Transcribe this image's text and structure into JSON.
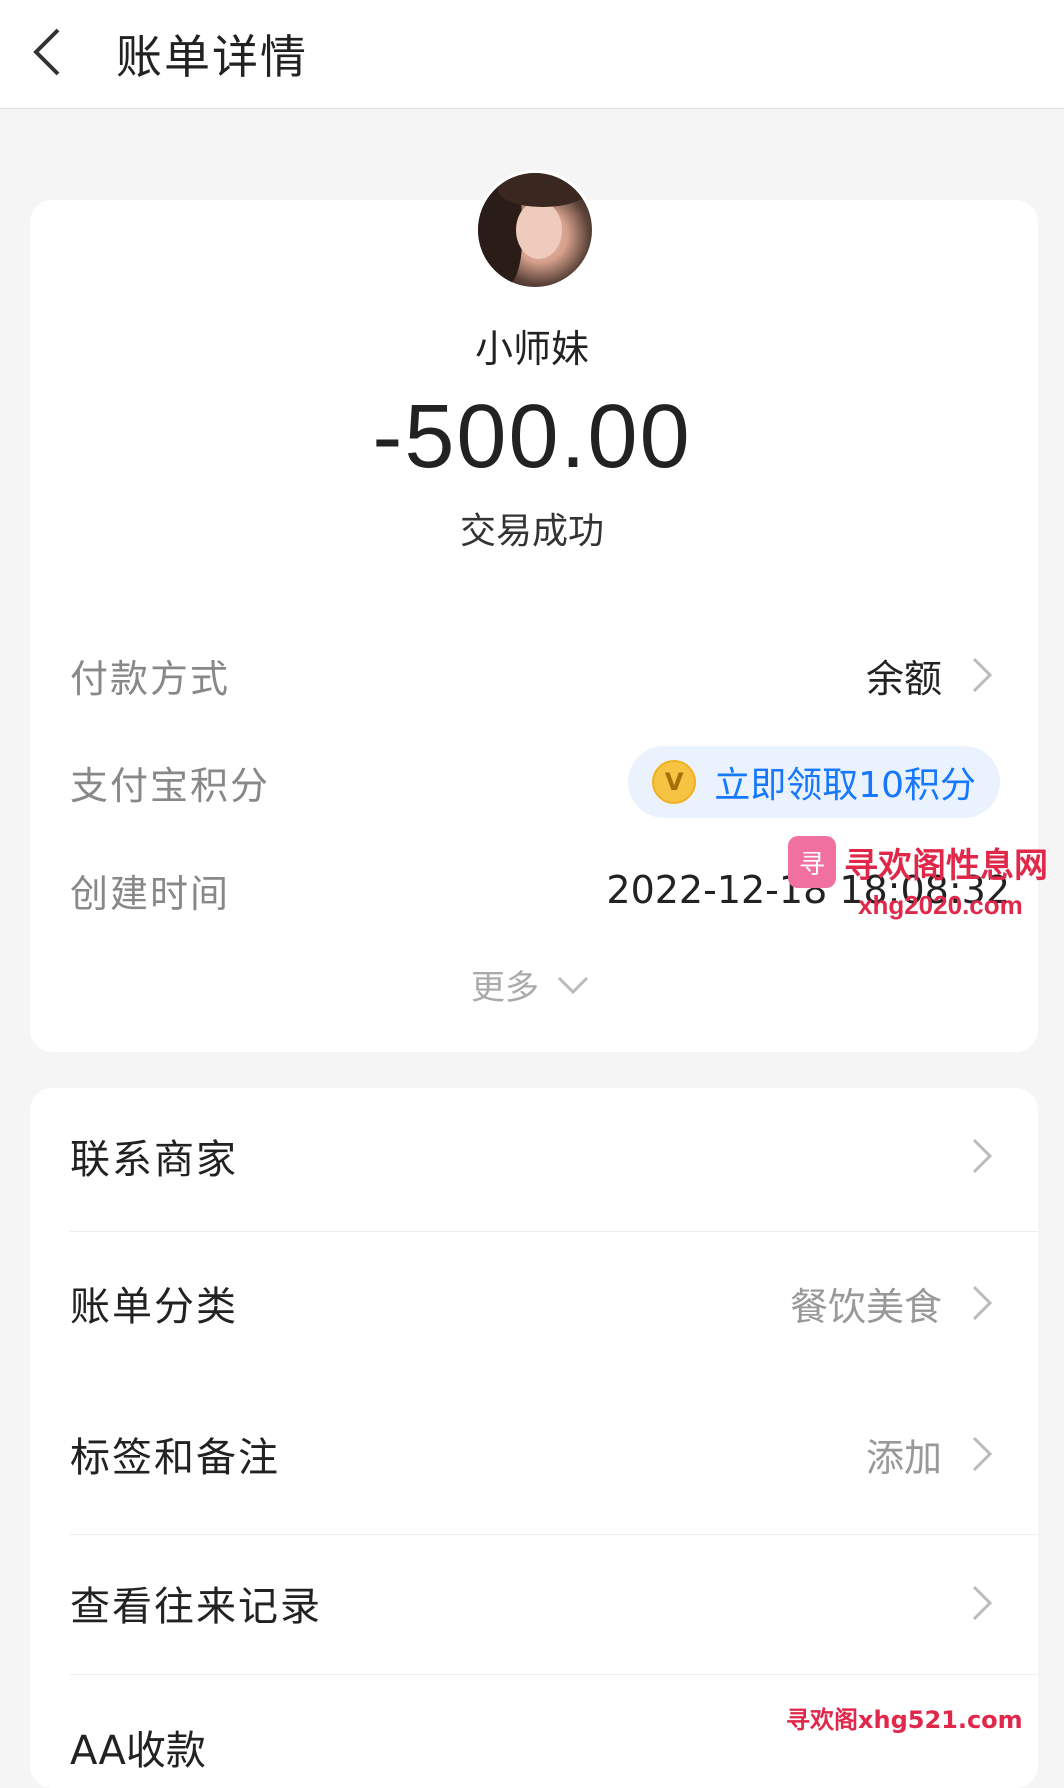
{
  "header": {
    "title": "账单详情",
    "back_icon": "back-arrow-icon"
  },
  "transaction": {
    "payee": "小师妹",
    "amount": "-500.00",
    "status": "交易成功"
  },
  "details": {
    "payment_method_label": "付款方式",
    "payment_method_value": "余额",
    "points_label": "支付宝积分",
    "points_action": "立即领取10积分",
    "created_label": "创建时间",
    "created_value": "2022-12-18 18:08:32",
    "more_label": "更多"
  },
  "actions": {
    "contact_label": "联系商家",
    "category_label": "账单分类",
    "category_value": "餐饮美食",
    "tags_label": "标签和备注",
    "tags_value": "添加",
    "history_label": "查看往来记录",
    "aa_label": "AA收款"
  },
  "watermark": {
    "site_name": "寻欢阁性息网",
    "site_url": "xhg2020.com",
    "footer_mark": "寻欢阁xhg521.com"
  },
  "colors": {
    "accent": "#1677ff",
    "watermark": "#e0284a",
    "coin": "#f6c343"
  }
}
